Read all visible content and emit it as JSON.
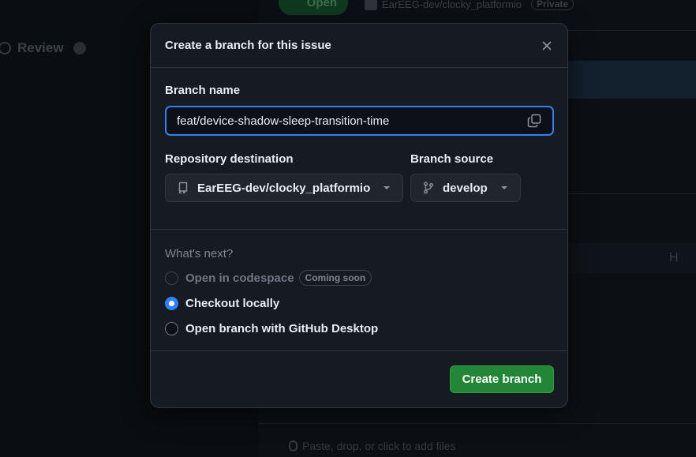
{
  "background": {
    "review_label": "Review",
    "open_label": "Open",
    "repo_label": "EarEEG-dev/clocky_platformio",
    "private_label": "Private",
    "h_label": "H",
    "paste_hint": "Paste, drop, or click to add files"
  },
  "dialog": {
    "title": "Create a branch for this issue",
    "close_icon": "x-icon",
    "branch_name": {
      "label": "Branch name",
      "value": "feat/device-shadow-sleep-transition-time",
      "copy_icon": "copy-icon"
    },
    "repository_destination": {
      "label": "Repository destination",
      "value": "EarEEG-dev/clocky_platformio",
      "icon": "repo-icon"
    },
    "branch_source": {
      "label": "Branch source",
      "value": "develop",
      "icon": "git-branch-icon"
    },
    "whats_next": {
      "label": "What's next?",
      "options": [
        {
          "label": "Open in codespace",
          "badge": "Coming soon",
          "selected": false,
          "disabled": true
        },
        {
          "label": "Checkout locally",
          "selected": true,
          "disabled": false
        },
        {
          "label": "Open branch with GitHub Desktop",
          "selected": false,
          "disabled": false
        }
      ]
    },
    "submit_label": "Create branch"
  },
  "colors": {
    "accent": "#2f81f7",
    "primary_button": "#238636",
    "dialog_bg": "#161b22",
    "border": "#30363d"
  }
}
